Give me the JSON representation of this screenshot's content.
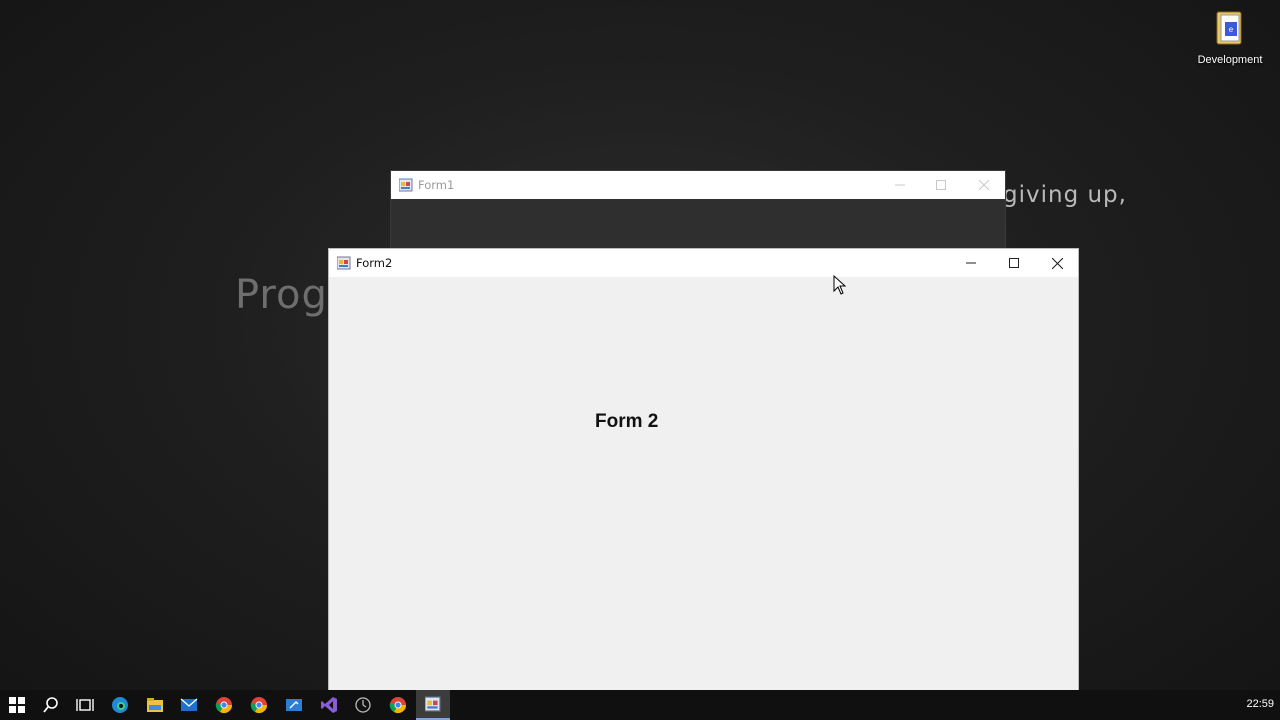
{
  "desktop": {
    "wallpaper_text_left": "Prog",
    "wallpaper_text_right": "giving up,",
    "icons": [
      {
        "label": "Development"
      }
    ]
  },
  "windows": {
    "form1": {
      "title": "Form1"
    },
    "form2": {
      "title": "Form2",
      "label": "Form 2"
    }
  },
  "taskbar": {
    "items": [
      "start-icon",
      "search-icon",
      "task-view-icon",
      "edge-icon",
      "file-explorer-icon",
      "mail-icon",
      "chrome-icon",
      "chrome-icon",
      "app-icon",
      "visual-studio-icon",
      "settings-icon",
      "chrome-icon",
      "form-app-icon"
    ],
    "clock": "22:59"
  },
  "colors": {
    "accent": "#7aa7d8",
    "window_bg": "#f0f0f0",
    "titlebar_bg": "#ffffff"
  }
}
